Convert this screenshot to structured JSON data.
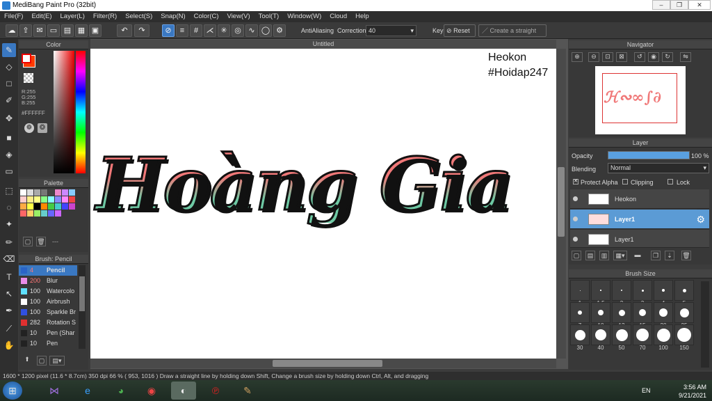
{
  "window": {
    "title": "MediBang Paint Pro (32bit)"
  },
  "menu": [
    "File(F)",
    "Edit(E)",
    "Layer(L)",
    "Filter(R)",
    "Select(S)",
    "Snap(N)",
    "Color(C)",
    "View(V)",
    "Tool(T)",
    "Window(W)",
    "Cloud",
    "Help"
  ],
  "toolbar": {
    "antialias": "AntiAliasing",
    "correction_label": "Correction",
    "correction_value": "40",
    "key_label": "Key",
    "reset": "Reset",
    "straight_line": "Create a straight line"
  },
  "color_panel": {
    "title": "Color",
    "r": "R:255",
    "g": "G:255",
    "b": "B:255",
    "hex": "#FFFFFF"
  },
  "palette_panel": {
    "title": "Palette",
    "footer": "---"
  },
  "brush_panel": {
    "title": "Brush: Pencil",
    "items": [
      {
        "size": "4",
        "name": "Pencil",
        "color": "#2a64c8"
      },
      {
        "size": "200",
        "name": "Blur",
        "color": "#e88de8"
      },
      {
        "size": "100",
        "name": "Watercolo",
        "color": "#5fe0ff"
      },
      {
        "size": "100",
        "name": "Airbrush",
        "color": "#ffffff"
      },
      {
        "size": "100",
        "name": "Sparkle Br",
        "color": "#3050e0"
      },
      {
        "size": "282",
        "name": "Rotation S",
        "color": "#e03030"
      },
      {
        "size": "10",
        "name": "Pen (Shar",
        "color": "#222222"
      },
      {
        "size": "10",
        "name": "Pen",
        "color": "#222222"
      }
    ]
  },
  "canvas": {
    "tab": "Untitled",
    "watermark1": "Heokon",
    "watermark2": "#Hoidap247",
    "art_line1": "Hoàng",
    "art_line2": "Gia"
  },
  "navigator": {
    "title": "Navigator"
  },
  "layer_panel": {
    "title": "Layer",
    "opacity_label": "Opacity",
    "opacity_value": "100 %",
    "opacity_percent": 100,
    "blending_label": "Blending",
    "blending_value": "Normal",
    "protect_alpha": "Protect Alpha",
    "clipping": "Clipping",
    "lock": "Lock",
    "layers": [
      {
        "name": "Heokon"
      },
      {
        "name": "Layer1"
      },
      {
        "name": "Layer1"
      }
    ]
  },
  "brush_size": {
    "title": "Brush Size",
    "sizes": [
      "1",
      "1.5",
      "2",
      "3",
      "4",
      "5",
      "7",
      "10",
      "12",
      "15",
      "20",
      "25",
      "30",
      "40",
      "50",
      "70",
      "100",
      "150"
    ]
  },
  "status": {
    "text": "1600 * 1200 pixel   (11.6 * 8.7cm)   350 dpi   66 %   ( 953, 1016 )   Draw a straight line by holding down Shift, Change a brush size by holding down Ctrl, Alt, and dragging"
  },
  "tray": {
    "lang": "EN",
    "time": "3:56 AM",
    "date": "9/21/2021"
  },
  "colors": {
    "accent": "#3a78c2",
    "pink": "#f07878",
    "green": "#6ec9a4"
  }
}
